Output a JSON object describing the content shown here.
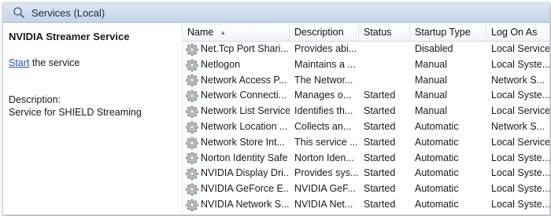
{
  "window": {
    "title": "Services (Local)"
  },
  "detail": {
    "service_name": "NVIDIA Streamer Service",
    "start_link": "Start",
    "start_suffix": " the service",
    "description_label": "Description:",
    "description_text": "Service for SHIELD Streaming"
  },
  "table": {
    "columns": [
      "Name",
      "Description",
      "Status",
      "Startup Type",
      "Log On As"
    ],
    "sort_indicator": "▲",
    "rows": [
      {
        "name": "Net.Tcp Port Shari...",
        "description": "Provides abi...",
        "status": "",
        "startup": "Disabled",
        "logon": "Local Service"
      },
      {
        "name": "Netlogon",
        "description": "Maintains a ...",
        "status": "",
        "startup": "Manual",
        "logon": "Local Syste..."
      },
      {
        "name": "Network Access P...",
        "description": "The Networ...",
        "status": "",
        "startup": "Manual",
        "logon": "Network S..."
      },
      {
        "name": "Network Connecti...",
        "description": "Manages o...",
        "status": "Started",
        "startup": "Manual",
        "logon": "Local Syste..."
      },
      {
        "name": "Network List Service",
        "description": "Identifies th...",
        "status": "Started",
        "startup": "Manual",
        "logon": "Local Service"
      },
      {
        "name": "Network Location ...",
        "description": "Collects an...",
        "status": "Started",
        "startup": "Automatic",
        "logon": "Network S..."
      },
      {
        "name": "Network Store Int...",
        "description": "This service ...",
        "status": "Started",
        "startup": "Automatic",
        "logon": "Local Service"
      },
      {
        "name": "Norton Identity Safe",
        "description": "Norton Iden...",
        "status": "Started",
        "startup": "Automatic",
        "logon": "Local Syste..."
      },
      {
        "name": "NVIDIA Display Dri...",
        "description": "Provides sys...",
        "status": "Started",
        "startup": "Automatic",
        "logon": "Local Syste..."
      },
      {
        "name": "NVIDIA GeForce E...",
        "description": "NVIDIA GeF...",
        "status": "Started",
        "startup": "Automatic",
        "logon": "Local Syste..."
      },
      {
        "name": "NVIDIA Network S...",
        "description": "NVIDIA Net...",
        "status": "Started",
        "startup": "Automatic",
        "logon": "Local Syste..."
      }
    ]
  },
  "icons": {
    "title": "services-magnifier-icon",
    "row": "service-gear-icon"
  }
}
